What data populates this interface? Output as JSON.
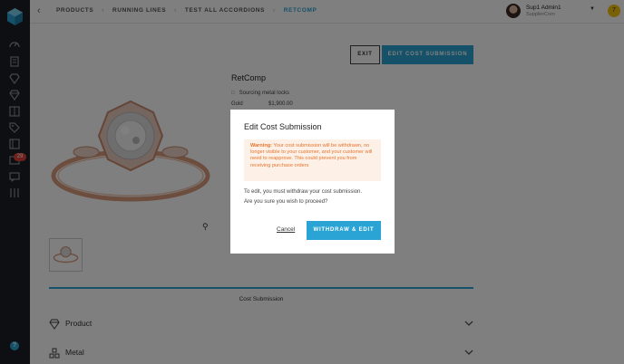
{
  "header": {
    "breadcrumbs": [
      "PRODUCTS",
      "RUNNING LINES",
      "TEST ALL ACCORDIONS",
      "RETCOMP"
    ],
    "user": {
      "name": "Sup1 Admin1",
      "company": "SupplierCom"
    },
    "notification_initial": "7"
  },
  "sidebar": {
    "badge_count": "29",
    "help_label": "?"
  },
  "toolbar": {
    "exit_label": "EXIT",
    "edit_label": "EDIT COST SUBMISSION"
  },
  "product": {
    "title": "RetComp",
    "lock_label": "Sourcing metal locks",
    "metal_label": "Gold",
    "metal_value": "$1,900.00"
  },
  "section": {
    "label": "Cost Submission",
    "accordions": [
      {
        "label": "Product",
        "icon": "diamond-icon"
      },
      {
        "label": "Metal",
        "icon": "metal-bars-icon"
      }
    ]
  },
  "modal": {
    "title": "Edit Cost Submission",
    "warning_label": "Warning:",
    "warning_text": "Your cost submission will be withdrawn, no longer visible to your customer, and your customer will need to reapprove. This could prevent you from receiving purchase orders",
    "text1": "To edit, you must withdraw your cost submission.",
    "text2": "Are you sure you wish to proceed?",
    "cancel_label": "Cancel",
    "confirm_label": "WITHDRAW & EDIT"
  },
  "colors": {
    "accent": "#2aa4d4",
    "sidebar": "#1b1f24",
    "warning_bg": "#fdf0e6",
    "warning_text": "#e4752f",
    "badge": "#e0433a"
  }
}
